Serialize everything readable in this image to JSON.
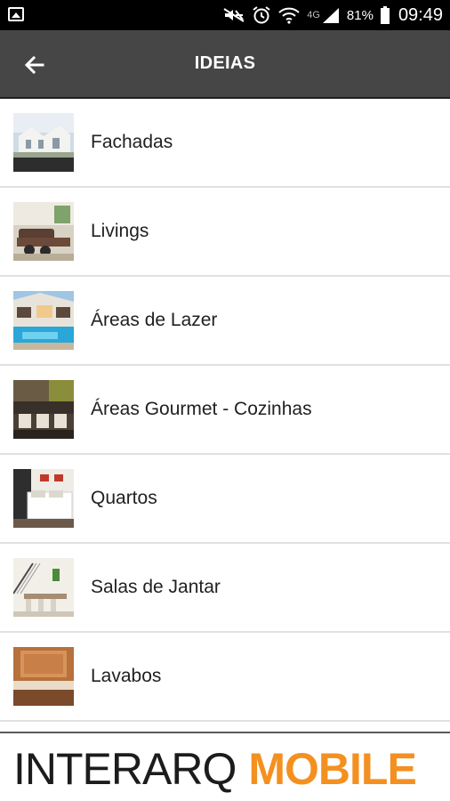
{
  "status_bar": {
    "battery": "81%",
    "network": "4G",
    "time": "09:49",
    "icons": [
      "image-icon",
      "mute-icon",
      "alarm-icon",
      "wifi-icon",
      "signal-icon",
      "battery-icon"
    ]
  },
  "toolbar": {
    "title": "IDEIAS",
    "back_icon": "arrow-left-icon"
  },
  "items": [
    {
      "label": "Fachadas",
      "thumb": "facade-photo"
    },
    {
      "label": "Livings",
      "thumb": "living-room-photo"
    },
    {
      "label": "Áreas de Lazer",
      "thumb": "pool-area-photo"
    },
    {
      "label": "Áreas Gourmet - Cozinhas",
      "thumb": "gourmet-kitchen-photo"
    },
    {
      "label": "Quartos",
      "thumb": "bedroom-photo"
    },
    {
      "label": "Salas de Jantar",
      "thumb": "dining-room-photo"
    },
    {
      "label": "Lavabos",
      "thumb": "washroom-photo"
    }
  ],
  "banner": {
    "brand_part1": "INTERARQ",
    "brand_part2": "MOBILE",
    "accent_color": "#f39020"
  }
}
